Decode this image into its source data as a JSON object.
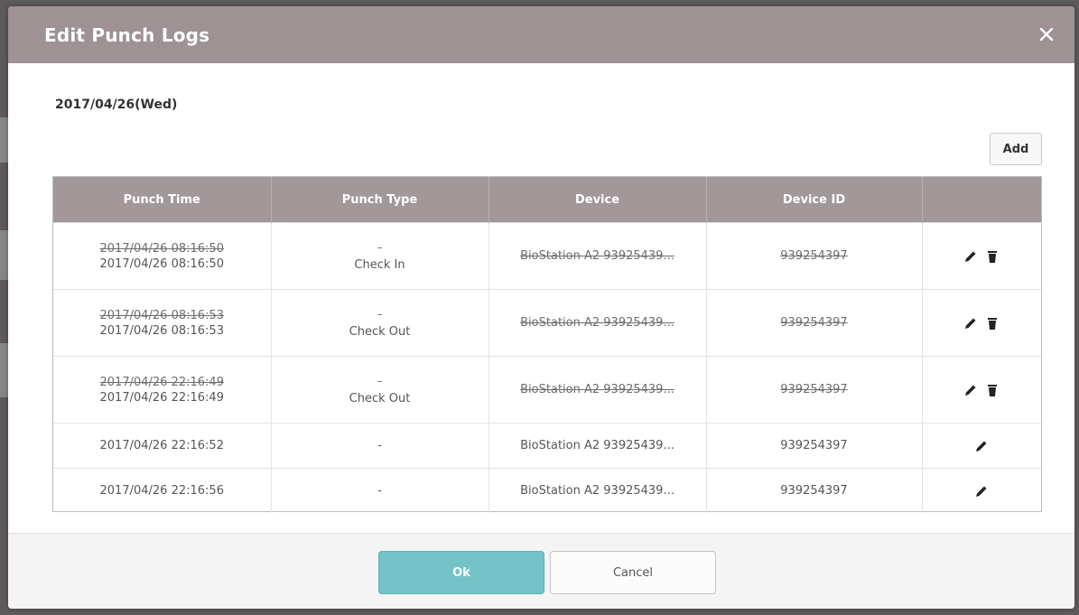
{
  "dialog": {
    "title": "Edit Punch Logs",
    "close_icon": "close-icon",
    "date": "2017/04/26(Wed)",
    "add_label": "Add"
  },
  "table": {
    "headers": [
      "Punch Time",
      "Punch Type",
      "Device",
      "Device ID",
      ""
    ],
    "rows": [
      {
        "punch_time_old": "2017/04/26 08:16:50",
        "punch_time_new": "2017/04/26 08:16:50",
        "punch_type_old": "–",
        "punch_type_new": "Check In",
        "device": "BioStation A2 93925439...",
        "device_id": "939254397",
        "edited": true,
        "actions": [
          "pencil-icon",
          "trash-icon"
        ]
      },
      {
        "punch_time_old": "2017/04/26 08:16:53",
        "punch_time_new": "2017/04/26 08:16:53",
        "punch_type_old": "–",
        "punch_type_new": "Check Out",
        "device": "BioStation A2 93925439...",
        "device_id": "939254397",
        "edited": true,
        "actions": [
          "pencil-icon",
          "trash-icon"
        ]
      },
      {
        "punch_time_old": "2017/04/26 22:16:49",
        "punch_time_new": "2017/04/26 22:16:49",
        "punch_type_old": "–",
        "punch_type_new": "Check Out",
        "device": "BioStation A2 93925439...",
        "device_id": "939254397",
        "edited": true,
        "actions": [
          "pencil-icon",
          "trash-icon"
        ]
      },
      {
        "punch_time": "2017/04/26 22:16:52",
        "punch_type": "-",
        "device": "BioStation A2 93925439...",
        "device_id": "939254397",
        "edited": false,
        "actions": [
          "pencil-icon"
        ]
      },
      {
        "punch_time": "2017/04/26 22:16:56",
        "punch_type": "-",
        "device": "BioStation A2 93925439...",
        "device_id": "939254397",
        "edited": false,
        "actions": [
          "pencil-icon"
        ]
      }
    ]
  },
  "footer": {
    "ok_label": "Ok",
    "cancel_label": "Cancel"
  },
  "colors": {
    "header_bg": "#9e9294",
    "table_header_bg": "#a29799",
    "ok_bg": "#73c2c8"
  }
}
